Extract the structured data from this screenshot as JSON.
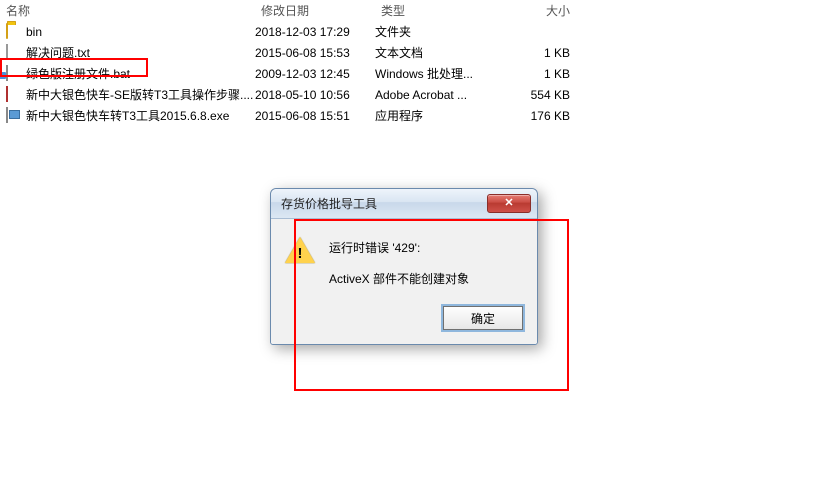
{
  "headers": {
    "name": "名称",
    "date": "修改日期",
    "type": "类型",
    "size": "大小"
  },
  "files": [
    {
      "icon": "folder",
      "name": "bin",
      "date": "2018-12-03 17:29",
      "type": "文件夹",
      "size": ""
    },
    {
      "icon": "txt",
      "name": "解决问题.txt",
      "date": "2015-06-08 15:53",
      "type": "文本文档",
      "size": "1 KB"
    },
    {
      "icon": "bat",
      "name": "绿色版注册文件.bat",
      "date": "2009-12-03 12:45",
      "type": "Windows 批处理...",
      "size": "1 KB"
    },
    {
      "icon": "pdf",
      "name": "新中大银色快车-SE版转T3工具操作步骤....",
      "date": "2018-05-10 10:56",
      "type": "Adobe Acrobat ...",
      "size": "554 KB"
    },
    {
      "icon": "exe",
      "name": "新中大银色快车转T3工具2015.6.8.exe",
      "date": "2015-06-08 15:51",
      "type": "应用程序",
      "size": "176 KB"
    }
  ],
  "dialog": {
    "title": "存货价格批导工具",
    "line1": "运行时错误 '429':",
    "line2": "ActiveX 部件不能创建对象",
    "ok": "确定"
  }
}
